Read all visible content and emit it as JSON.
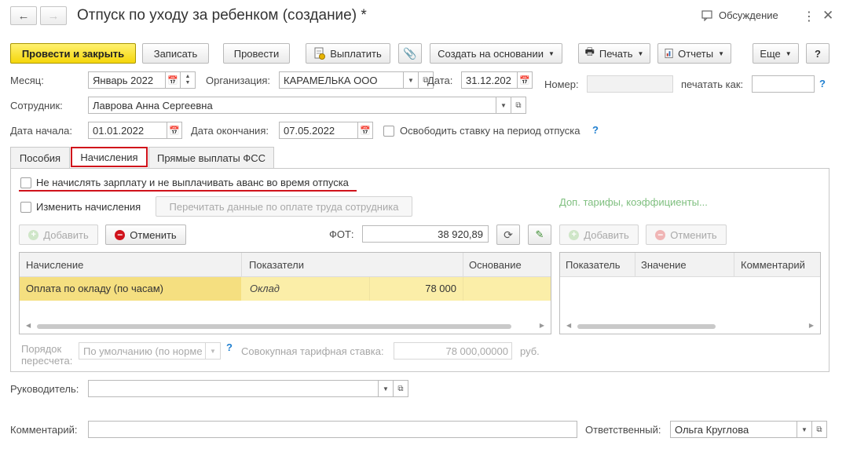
{
  "header": {
    "title": "Отпуск по уходу за ребенком (создание) *",
    "discussion_label": "Обсуждение",
    "more_icon": "more-vertical-icon",
    "close_icon": "close-icon"
  },
  "toolbar": {
    "post_and_close": "Провести и закрыть",
    "save": "Записать",
    "post": "Провести",
    "pay": "Выплатить",
    "create_based_on": "Создать на основании",
    "print": "Печать",
    "reports": "Отчеты",
    "more": "Еще",
    "help": "?"
  },
  "form": {
    "month_label": "Месяц:",
    "month_value": "Январь 2022",
    "org_label": "Организация:",
    "org_value": "КАРАМЕЛЬКА ООО",
    "date_label": "Дата:",
    "date_value": "31.12.202",
    "number_label": "Номер:",
    "number_value": "",
    "print_as_label": "печатать как:",
    "print_as_value": "",
    "employee_label": "Сотрудник:",
    "employee_value": "Лаврова Анна Сергеевна",
    "start_label": "Дата начала:",
    "start_value": "01.01.2022",
    "end_label": "Дата окончания:",
    "end_value": "07.05.2022",
    "free_rate_label": "Освободить ставку на период отпуска",
    "help_mark": "?"
  },
  "tabs": [
    {
      "label": "Пособия"
    },
    {
      "label": "Начисления"
    },
    {
      "label": "Прямые выплаты ФСС"
    }
  ],
  "accruals": {
    "no_salary_label": "Не начислять зарплату и не выплачивать аванс во время отпуска",
    "change_accruals_label": "Изменить начисления",
    "reread_button": "Перечитать данные по оплате труда сотрудника",
    "extra_rates_link": "Доп. тарифы, коэффициенты...",
    "add_button": "Добавить",
    "cancel_button": "Отменить",
    "fot_label": "ФОТ:",
    "fot_value": "38 920,89",
    "columns": [
      "Начисление",
      "Показатели",
      "Основание"
    ],
    "rows": [
      {
        "accrual": "Оплата по окладу (по часам)",
        "indicator": "Оклад",
        "amount": "78 000",
        "basis": ""
      }
    ],
    "right_add_button": "Добавить",
    "right_cancel_button": "Отменить",
    "right_columns": [
      "Показатель",
      "Значение",
      "Комментарий"
    ],
    "recalc_label_1": "Порядок",
    "recalc_label_2": "пересчета:",
    "recalc_value": "По умолчанию (по норме",
    "total_rate_label": "Совокупная тарифная ставка:",
    "total_rate_value": "78 000,00000",
    "currency": "руб."
  },
  "footer": {
    "manager_label": "Руководитель:",
    "manager_value": "",
    "comment_label": "Комментарий:",
    "comment_value": "",
    "responsible_label": "Ответственный:",
    "responsible_value": "Ольга Круглова"
  },
  "colors": {
    "primary_button": "#f5d60a",
    "highlight_red": "#d0121b",
    "selected_row": "#fbeea8",
    "link_green": "#7fbf7f",
    "help_blue": "#1f7fd0"
  }
}
